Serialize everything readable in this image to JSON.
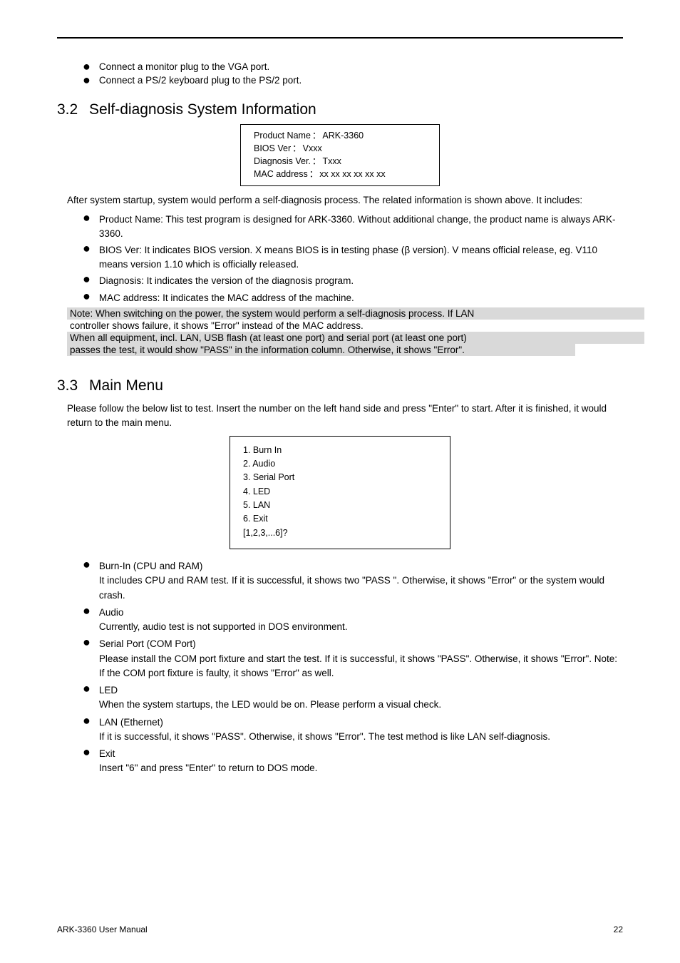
{
  "top_list": [
    "Connect a monitor plug to the VGA port.",
    "Connect a PS/2 keyboard plug to the PS/2 port."
  ],
  "sec32": {
    "number": "3.2",
    "title": "Self-diagnosis System Information"
  },
  "sys_info": {
    "r1": {
      "label": "Product Name",
      "value": "ARK-3360"
    },
    "r2": {
      "label": "BIOS Ver",
      "value": "Vxxx"
    },
    "r3": {
      "label": "Diagnosis Ver.",
      "value": "Txxx"
    },
    "r4": {
      "label": "MAC address",
      "value": "xx xx xx xx xx xx"
    }
  },
  "sys_para": "After system startup, system would perform a self-diagnosis process. The related information is shown above. It includes:",
  "sys_bullets": [
    "Product Name: This test program is designed for ARK-3360. Without additional change, the product name is always ARK-3360.",
    "BIOS Ver: It indicates BIOS version. X means BIOS is in testing phase (β version). V means official release, eg. V110 means version 1.10 which is officially released.",
    "Diagnosis: It indicates the version of the diagnosis program.",
    "MAC address: It indicates the MAC address of the machine."
  ],
  "note": {
    "l1": "Note: When switching on the power, the system would perform a self-diagnosis process. If LAN",
    "l2": "controller shows failure, it shows \"Error\" instead of the MAC address.",
    "l3": "When all equipment, incl. LAN, USB flash (at least one port) and serial port (at least one port)",
    "l4": "passes the test, it would show \"PASS\" in the information column. Otherwise, it shows \"Error\"."
  },
  "sec33": {
    "number": "3.3",
    "title": "Main Menu"
  },
  "menu_para": "Please follow the below list to test. Insert the number on the left hand side and press \"Enter\" to start. After it is finished, it would return to the main menu.",
  "menu_box": [
    "1. Burn In",
    "2. Audio",
    "3. Serial Port",
    "4. LED",
    "5. LAN",
    "6. Exit",
    "[1,2,3,...6]?"
  ],
  "menu_bullets": [
    {
      "label": "Burn-In (CPU and RAM)",
      "text": "It includes CPU and RAM test. If it is successful, it shows two \"PASS \". Otherwise, it shows \"Error\" or the system would crash."
    },
    {
      "label": "Audio",
      "text": "Currently, audio test is not supported in DOS environment."
    },
    {
      "label": "Serial Port (COM Port)",
      "text": "Please install the COM port fixture and start the test. If it is successful, it shows \"PASS\". Otherwise, it shows \"Error\". Note: If the COM port fixture is faulty, it shows \"Error\" as well."
    },
    {
      "label": "LED",
      "text": "When the system startups, the LED would be on. Please perform a visual check."
    },
    {
      "label": "LAN (Ethernet)",
      "text": "If it is successful, it shows \"PASS\". Otherwise, it shows \"Error\". The test method is like LAN self-diagnosis."
    },
    {
      "label": "Exit",
      "text": "Insert \"6\" and press \"Enter\" to return to DOS mode."
    }
  ],
  "footer": {
    "left": "ARK-3360 User Manual",
    "right": "22"
  }
}
